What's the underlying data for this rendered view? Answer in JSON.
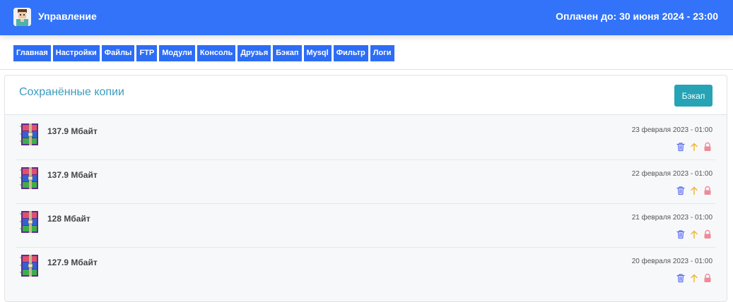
{
  "header": {
    "title": "Управление",
    "paid_until": "Оплачен до: 30 июня 2024 - 23:00",
    "logo_icon": "avatar-logo-icon"
  },
  "nav": {
    "tabs": [
      "Главная",
      "Настройки",
      "Файлы",
      "FTP",
      "Модули",
      "Консоль",
      "Друзья",
      "Бэкап",
      "Mysql",
      "Фильтр",
      "Логи"
    ]
  },
  "backups": {
    "title": "Сохранённые копии",
    "button_label": "Бэкап",
    "items": [
      {
        "size": "137.9 Мбайт",
        "date": "23 февраля 2023 - 01:00"
      },
      {
        "size": "137.9 Мбайт",
        "date": "22 февраля 2023 - 01:00"
      },
      {
        "size": "128 Мбайт",
        "date": "21 февраля 2023 - 01:00"
      },
      {
        "size": "127.9 Мбайт",
        "date": "20 февраля 2023 - 01:00"
      }
    ],
    "action_icons": [
      "trash-icon",
      "arrow-up-icon",
      "lock-icon"
    ]
  },
  "colors": {
    "topbar": "#3273fa",
    "tab": "#2d6df5",
    "title": "#3c9bbd",
    "button": "#26a3b5",
    "trash": "#5b6df0",
    "restore": "#f0b429",
    "lock": "#ef8a9a"
  }
}
